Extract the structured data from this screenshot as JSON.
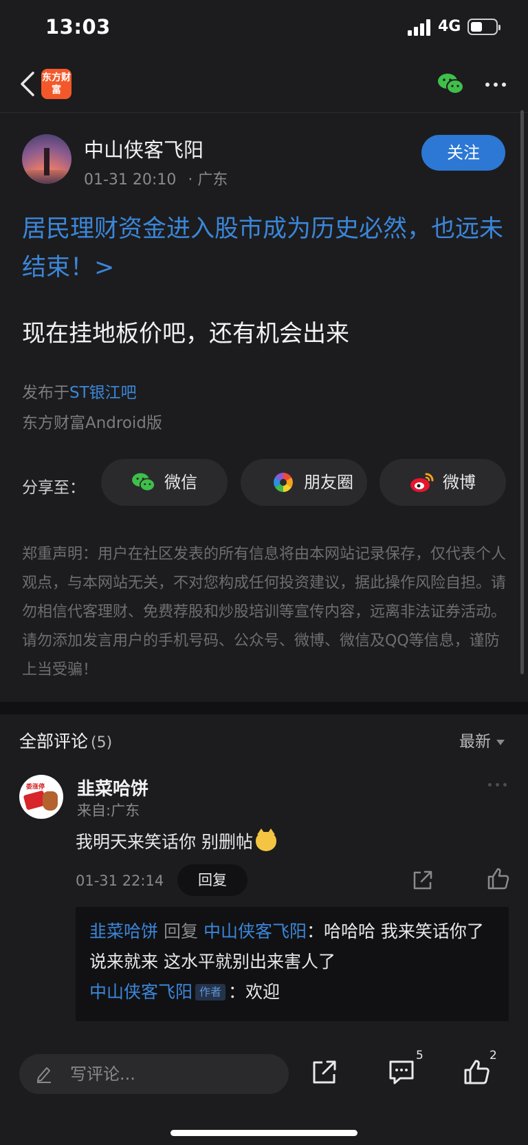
{
  "status_bar": {
    "time": "13:03",
    "network": "4G"
  },
  "nav": {
    "logo_text": "东方财富"
  },
  "post": {
    "author": "中山侠客飞阳",
    "time": "01-31 20:10",
    "location": "· 广东",
    "follow_label": "关注",
    "title": "居民理财资金进入股市成为历史必然，也远未结束！>",
    "body": "现在挂地板价吧，还有机会出来",
    "published_prefix": "发布于",
    "forum": "ST银江吧",
    "client": "东方财富Android版",
    "share_label": "分享至：",
    "share_options": [
      "微信",
      "朋友圈",
      "微博"
    ],
    "disclaimer": "郑重声明：用户在社区发表的所有信息将由本网站记录保存，仅代表个人观点，与本网站无关，不对您构成任何投资建议，据此操作风险自担。请勿相信代客理财、免费荐股和炒股培训等宣传内容，远离非法证券活动。请勿添加发言用户的手机号码、公众号、微博、微信及QQ等信息，谨防上当受骗！"
  },
  "comments": {
    "title": "全部评论",
    "count": "(5)",
    "sort": "最新",
    "items": [
      {
        "avatar_text": "委涨停",
        "name": "韭菜哈饼",
        "from": "来自:广东",
        "text": "我明天来笑话你 别删帖",
        "time": "01-31 22:14",
        "reply_label": "回复",
        "replies": {
          "r1_user": "韭菜哈饼",
          "r1_verb": "回复",
          "r1_target": "中山侠客飞阳",
          "r1_text": "：哈哈哈 我来笑话你了 说来就来 这水平就别出来害人了",
          "r2_user": "中山侠客飞阳",
          "r2_badge": "作者",
          "r2_text": "：欢迎"
        }
      }
    ]
  },
  "bottom_bar": {
    "input_placeholder": "写评论...",
    "comment_count": "5",
    "like_count": "2"
  },
  "colors": {
    "accent_blue": "#3b86d9",
    "follow_button": "#2c78d4",
    "logo_orange": "#f4582a",
    "wechat_green": "#3fbf4a",
    "background": "#1c1c1e"
  },
  "icons": [
    "back-icon",
    "wechat-icon",
    "more-icon",
    "moments-icon",
    "weibo-icon",
    "share-icon",
    "like-icon",
    "pencil-icon",
    "comment-icon"
  ]
}
